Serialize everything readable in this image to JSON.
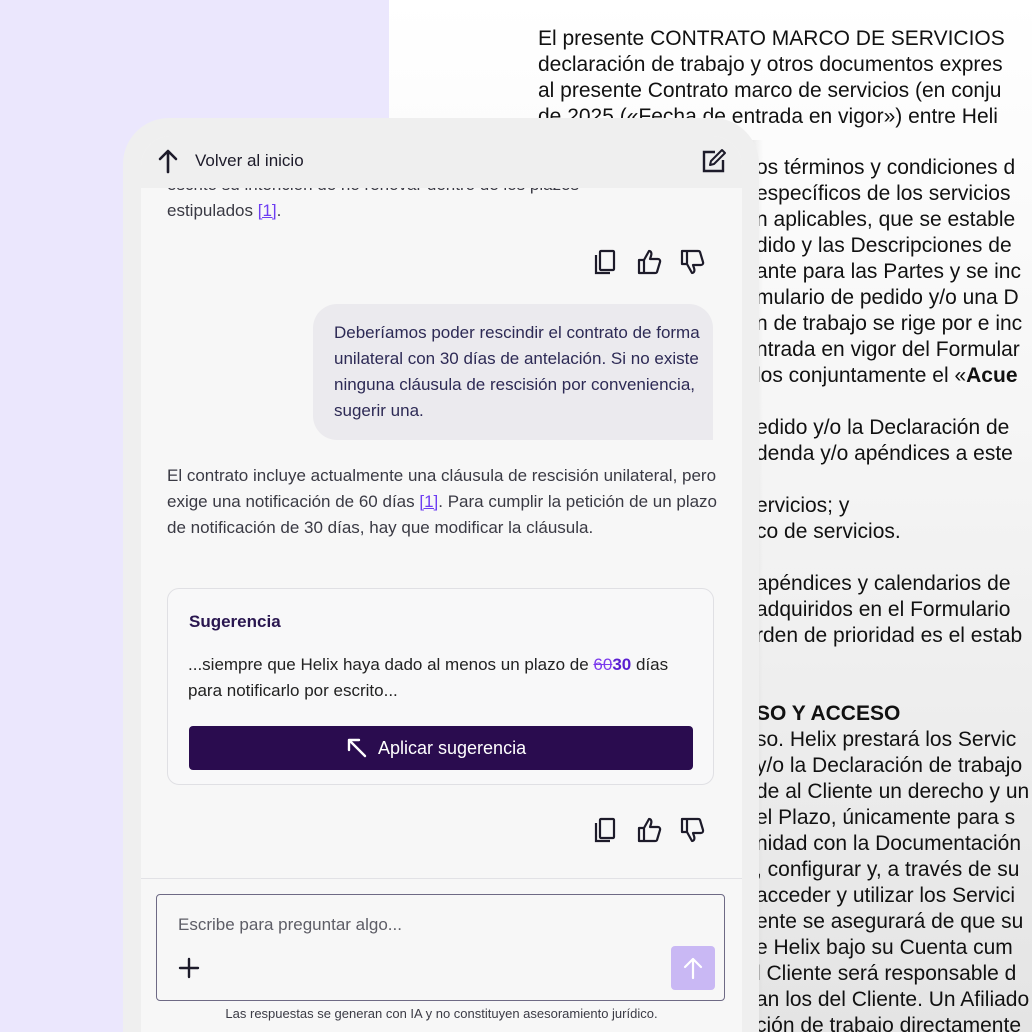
{
  "document": {
    "top_lines": [
      "El presente CONTRATO MARCO DE SERVICIOS",
      "declaración de trabajo y otros documentos expres",
      "al presente Contrato marco de servicios (en conju",
      "de 2025 («Fecha de entrada en vigor») entre Heli"
    ],
    "right_lines": [
      "os términos y condiciones d",
      " específicos de los servicios",
      "n aplicables, que se estable",
      "dido y las Descripciones de",
      "ante para las Partes y se inc",
      "mulario de pedido y/o una D",
      "n de trabajo se rige por e inc",
      "ntrada en vigor del Formular",
      "los conjuntamente el «",
      "",
      "edido y/o la Declaración de",
      "denda y/o apéndices a este",
      "",
      "ervicios; y",
      "co de servicios.",
      "",
      " apéndices y calendarios de",
      "adquiridos en el Formulario",
      "rden de prioridad es el estab",
      "",
      "",
      "SO Y ACCESO",
      "so. Helix prestará los Servic",
      "y/o la Declaración de trabajo",
      "de al Cliente un derecho y un",
      "el Plazo, únicamente para s",
      "nidad con la Documentación",
      ", configurar y, a través de su",
      "acceder y utilizar los Servici",
      "ente se asegurará de que su",
      "e Helix bajo su Cuenta cum",
      "l Cliente será responsable d",
      "an los del Cliente. Un Afiliado",
      "ción de trabajo directamente"
    ],
    "bold_fragment": "Acue"
  },
  "header": {
    "back_label": "Volver al inicio"
  },
  "messages": {
    "first_tail_line1": "escrito su intención de no renovar dentro de los plazos",
    "first_tail_line2": "estipulados ",
    "first_tail_cite": "[1]",
    "first_tail_end": ".",
    "user_text": "Deberíamos poder rescindir el contrato de forma unilateral con 30 días de antelación. Si no existe ninguna cláusula de rescisión por conveniencia, sugerir una.",
    "reply_part1": "El contrato incluye actualmente una cláusula de rescisión unilateral, pero exige una notificación de 60 días ",
    "reply_cite": "[1]",
    "reply_part2": ". Para cumplir la petición de un plazo de notificación de 30 días, hay que modificar la cláusula."
  },
  "suggestion": {
    "title": "Sugerencia",
    "text_before": "...siempre que Helix haya dado al menos un plazo de ",
    "deleted": "60",
    "inserted": "30",
    "text_after": " días para notificarlo por escrito...",
    "apply_label": "Aplicar sugerencia"
  },
  "composer": {
    "placeholder": "Escribe para preguntar algo...",
    "disclaimer": "Las respuestas se generan con IA y no constituyen asesoramiento jurídico."
  },
  "icons": {
    "back": "arrow-up-icon",
    "edit": "edit-icon",
    "copy": "copy-icon",
    "like": "thumbs-up-icon",
    "dislike": "thumbs-down-icon",
    "apply": "arrow-up-left-icon",
    "attach": "plus-icon",
    "send": "arrow-up-icon"
  },
  "colors": {
    "accent": "#6d3df2",
    "primary_button": "#2a0c4f",
    "send_button": "#c9b8f4",
    "lilac_background": "#ebe7fd"
  }
}
